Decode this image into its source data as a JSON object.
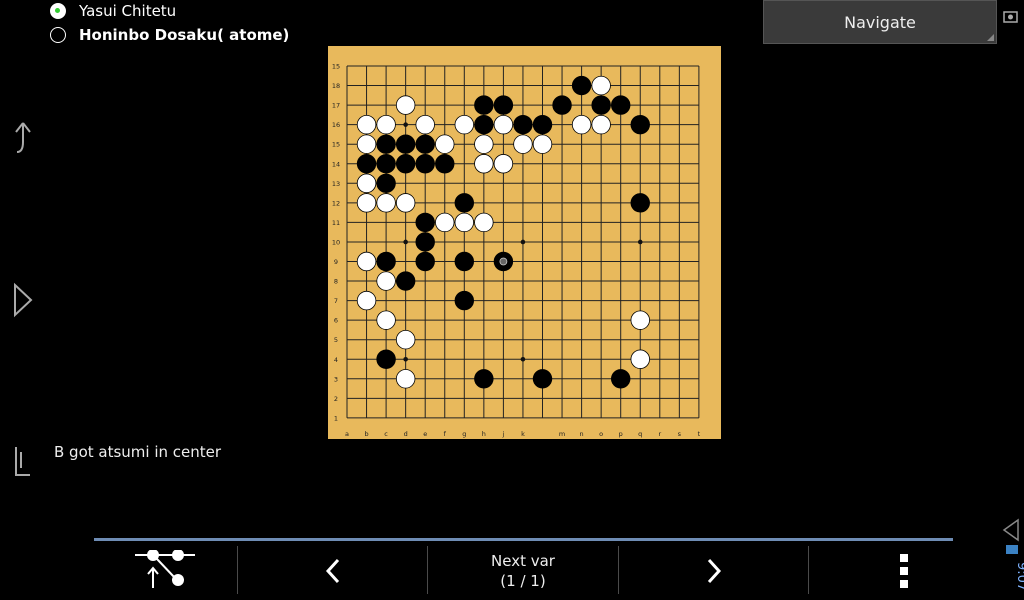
{
  "players": {
    "white": "Yasui Chitetu",
    "black": "Honinbo Dosaku( atome)"
  },
  "navigate_label": "Navigate",
  "comment": "B got atsumi in center",
  "bottom_bar": {
    "next_var_label": "Next var",
    "next_var_count": "(1 / 1)"
  },
  "status_bar": {
    "time": "9:07"
  },
  "board": {
    "columns": [
      "a",
      "b",
      "c",
      "d",
      "e",
      "f",
      "g",
      "h",
      "j",
      "k",
      "l",
      "m",
      "n",
      "o",
      "p",
      "q",
      "r",
      "s",
      "t"
    ],
    "rows": [
      "19",
      "18",
      "17",
      "16",
      "15",
      "14",
      "13",
      "12",
      "11",
      "10",
      "9",
      "8",
      "7",
      "6",
      "5",
      "4",
      "3",
      "2",
      "1"
    ],
    "row_labels_shown": [
      "15",
      "18",
      "17",
      "16",
      "15",
      "14",
      "13",
      "12",
      "11",
      "10",
      "9",
      "8",
      "7",
      "6",
      "5",
      "4",
      "3",
      "2",
      "1"
    ],
    "col_labels_shown": [
      "a",
      "b",
      "c",
      "d",
      "e",
      "f",
      "g",
      "h",
      "j",
      "k",
      "",
      "m",
      "n",
      "o",
      "p",
      "q",
      "r",
      "s",
      "t"
    ],
    "star_points": [
      [
        3,
        3
      ],
      [
        3,
        9
      ],
      [
        3,
        15
      ],
      [
        9,
        3
      ],
      [
        9,
        9
      ],
      [
        9,
        15
      ],
      [
        15,
        3
      ],
      [
        15,
        9
      ],
      [
        15,
        15
      ]
    ],
    "black_stones": [
      [
        12,
        1
      ],
      [
        11,
        2
      ],
      [
        13,
        2
      ],
      [
        14,
        2
      ],
      [
        7,
        2
      ],
      [
        8,
        2
      ],
      [
        7,
        3
      ],
      [
        9,
        3
      ],
      [
        10,
        3
      ],
      [
        15,
        3
      ],
      [
        2,
        4
      ],
      [
        3,
        4
      ],
      [
        4,
        4
      ],
      [
        2,
        5
      ],
      [
        3,
        5
      ],
      [
        4,
        5
      ],
      [
        5,
        5
      ],
      [
        1,
        5
      ],
      [
        1,
        6
      ],
      [
        2,
        6
      ],
      [
        6,
        7
      ],
      [
        15,
        7
      ],
      [
        4,
        8
      ],
      [
        4,
        9
      ],
      [
        2,
        10
      ],
      [
        4,
        10
      ],
      [
        6,
        10
      ],
      [
        3,
        11
      ],
      [
        6,
        12
      ],
      [
        2,
        15
      ],
      [
        7,
        16
      ],
      [
        10,
        16
      ],
      [
        14,
        16
      ]
    ],
    "white_stones": [
      [
        13,
        1
      ],
      [
        3,
        2
      ],
      [
        1,
        3
      ],
      [
        2,
        3
      ],
      [
        4,
        3
      ],
      [
        6,
        3
      ],
      [
        8,
        3
      ],
      [
        12,
        3
      ],
      [
        13,
        3
      ],
      [
        5,
        4
      ],
      [
        7,
        4
      ],
      [
        9,
        4
      ],
      [
        10,
        4
      ],
      [
        7,
        5
      ],
      [
        8,
        5
      ],
      [
        1,
        4
      ],
      [
        1,
        6
      ],
      [
        1,
        7
      ],
      [
        2,
        7
      ],
      [
        3,
        7
      ],
      [
        5,
        8
      ],
      [
        6,
        8
      ],
      [
        7,
        8
      ],
      [
        1,
        10
      ],
      [
        2,
        11
      ],
      [
        1,
        12
      ],
      [
        2,
        13
      ],
      [
        15,
        13
      ],
      [
        3,
        14
      ],
      [
        15,
        15
      ],
      [
        3,
        16
      ]
    ],
    "last_move": [
      8,
      10
    ]
  }
}
